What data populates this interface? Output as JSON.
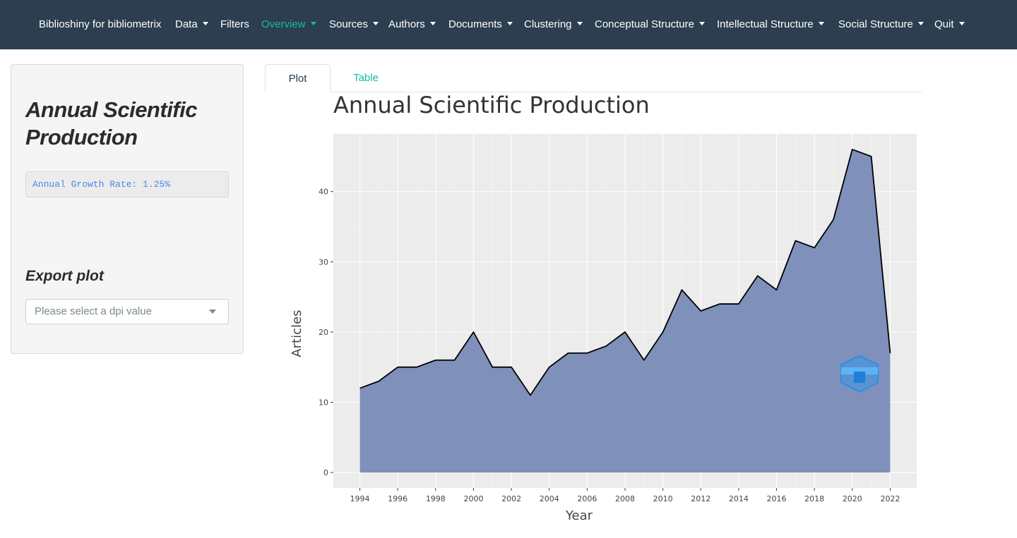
{
  "navbar": {
    "brand": "Biblioshiny for bibliometrix",
    "items": [
      {
        "label": "Data",
        "dropdown": true,
        "active": false
      },
      {
        "label": "Filters",
        "dropdown": false,
        "active": false
      },
      {
        "label": "Overview",
        "dropdown": true,
        "active": true
      },
      {
        "label": "Sources",
        "dropdown": true,
        "active": false
      },
      {
        "label": "Authors",
        "dropdown": true,
        "active": false
      },
      {
        "label": "Documents",
        "dropdown": true,
        "active": false
      },
      {
        "label": "Clustering",
        "dropdown": true,
        "active": false
      },
      {
        "label": "Conceptual Structure",
        "dropdown": true,
        "active": false
      },
      {
        "label": "Intellectual Structure",
        "dropdown": true,
        "active": false
      },
      {
        "label": "Social Structure",
        "dropdown": true,
        "active": false
      },
      {
        "label": "Quit",
        "dropdown": true,
        "active": false
      }
    ],
    "colors": {
      "background": "#2c3e50",
      "text": "#ffffff",
      "active": "#18bc9c"
    }
  },
  "sidebar": {
    "title": "Annual Scientific Production",
    "growth_rate": "Annual Growth Rate: 1.25%",
    "export_title": "Export plot",
    "dpi_placeholder": "Please select a dpi value"
  },
  "tabs": [
    {
      "label": "Plot",
      "active": true
    },
    {
      "label": "Table",
      "active": false
    }
  ],
  "chart_data": {
    "type": "area",
    "title": "Annual Scientific Production",
    "xlabel": "Year",
    "ylabel": "Articles",
    "x": [
      1994,
      1995,
      1996,
      1997,
      1998,
      1999,
      2000,
      2001,
      2002,
      2003,
      2004,
      2005,
      2006,
      2007,
      2008,
      2009,
      2010,
      2011,
      2012,
      2013,
      2014,
      2015,
      2016,
      2017,
      2018,
      2019,
      2020,
      2021,
      2022
    ],
    "values": [
      12,
      13,
      15,
      15,
      16,
      16,
      20,
      15,
      15,
      11,
      15,
      17,
      17,
      18,
      20,
      16,
      20,
      26,
      23,
      24,
      24,
      28,
      26,
      33,
      32,
      36,
      46,
      45,
      17
    ],
    "x_ticks": [
      1994,
      1996,
      1998,
      2000,
      2002,
      2004,
      2006,
      2008,
      2010,
      2012,
      2014,
      2016,
      2018,
      2020,
      2022
    ],
    "y_ticks": [
      0,
      10,
      20,
      30,
      40
    ],
    "xlim": [
      1992.6,
      2023.4
    ],
    "ylim": [
      -2.2,
      48.2
    ],
    "grid": true,
    "fill_color": "#7f90bb",
    "line_color": "#000000",
    "panel_color": "#ececec",
    "logo": "bibliometrix-hexagon-logo"
  }
}
